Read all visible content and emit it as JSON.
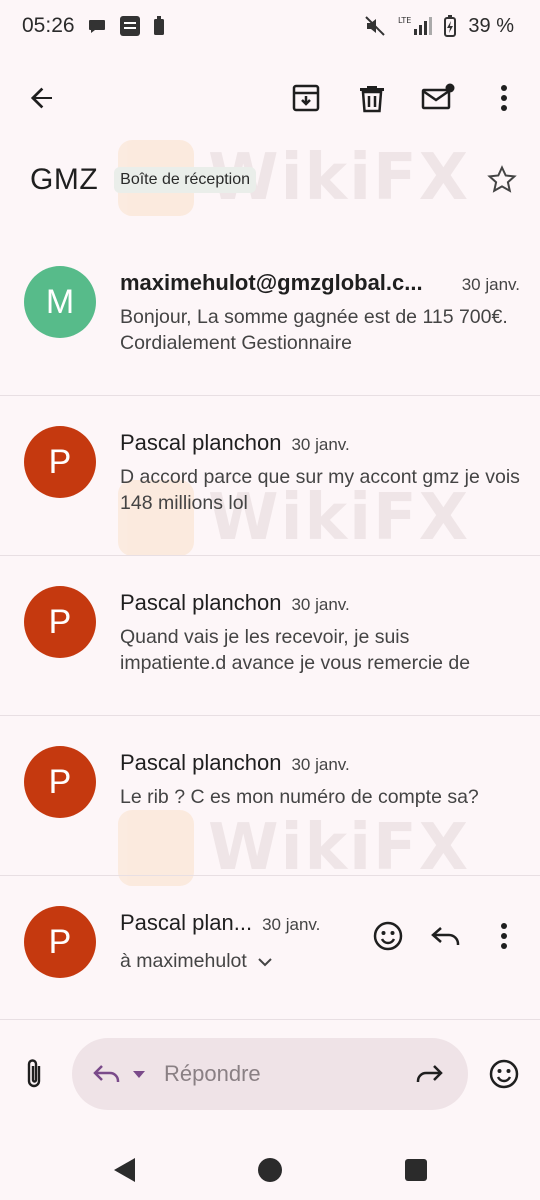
{
  "status": {
    "time": "05:26",
    "battery": "39 %",
    "network": "LTE"
  },
  "thread": {
    "subject": "GMZ",
    "label": "Boîte de réception"
  },
  "messages": [
    {
      "avatar_letter": "M",
      "avatar_color": "#57bb8a",
      "sender": "maximehulot@gmzglobal.c...",
      "date": "30 janv.",
      "snippet": "Bonjour, La somme gagnée est de 115 700€. Cordialement Gestionnaire"
    },
    {
      "avatar_letter": "P",
      "avatar_color": "#c5390f",
      "sender": "Pascal planchon",
      "date": "30 janv.",
      "snippet": "D accord parce que sur my accont gmz je vois 148 millions lol"
    },
    {
      "avatar_letter": "P",
      "avatar_color": "#c5390f",
      "sender": "Pascal planchon",
      "date": "30 janv.",
      "snippet": "Quand vais je les recevoir, je suis impatiente.d avance je vous remercie de"
    },
    {
      "avatar_letter": "P",
      "avatar_color": "#c5390f",
      "sender": "Pascal planchon",
      "date": "30 janv.",
      "snippet": "Le rib ? C es mon numéro de compte sa?"
    },
    {
      "avatar_letter": "P",
      "avatar_color": "#c5390f",
      "sender": "Pascal plan...",
      "date": "30 janv.",
      "recipient": "à maximehulot"
    }
  ],
  "compose": {
    "placeholder": "Répondre"
  },
  "watermark": {
    "text": "WikiFX"
  },
  "colors": {
    "background": "#fdf6f8",
    "compose_bg": "#efe3e7",
    "accent": "#7a4a8a"
  },
  "icons": [
    "back-arrow-icon",
    "archive-icon",
    "trash-icon",
    "mark-unread-icon",
    "more-vert-icon",
    "star-icon",
    "emoji-icon",
    "reply-icon",
    "forward-icon",
    "attach-icon",
    "chevron-down-icon"
  ]
}
